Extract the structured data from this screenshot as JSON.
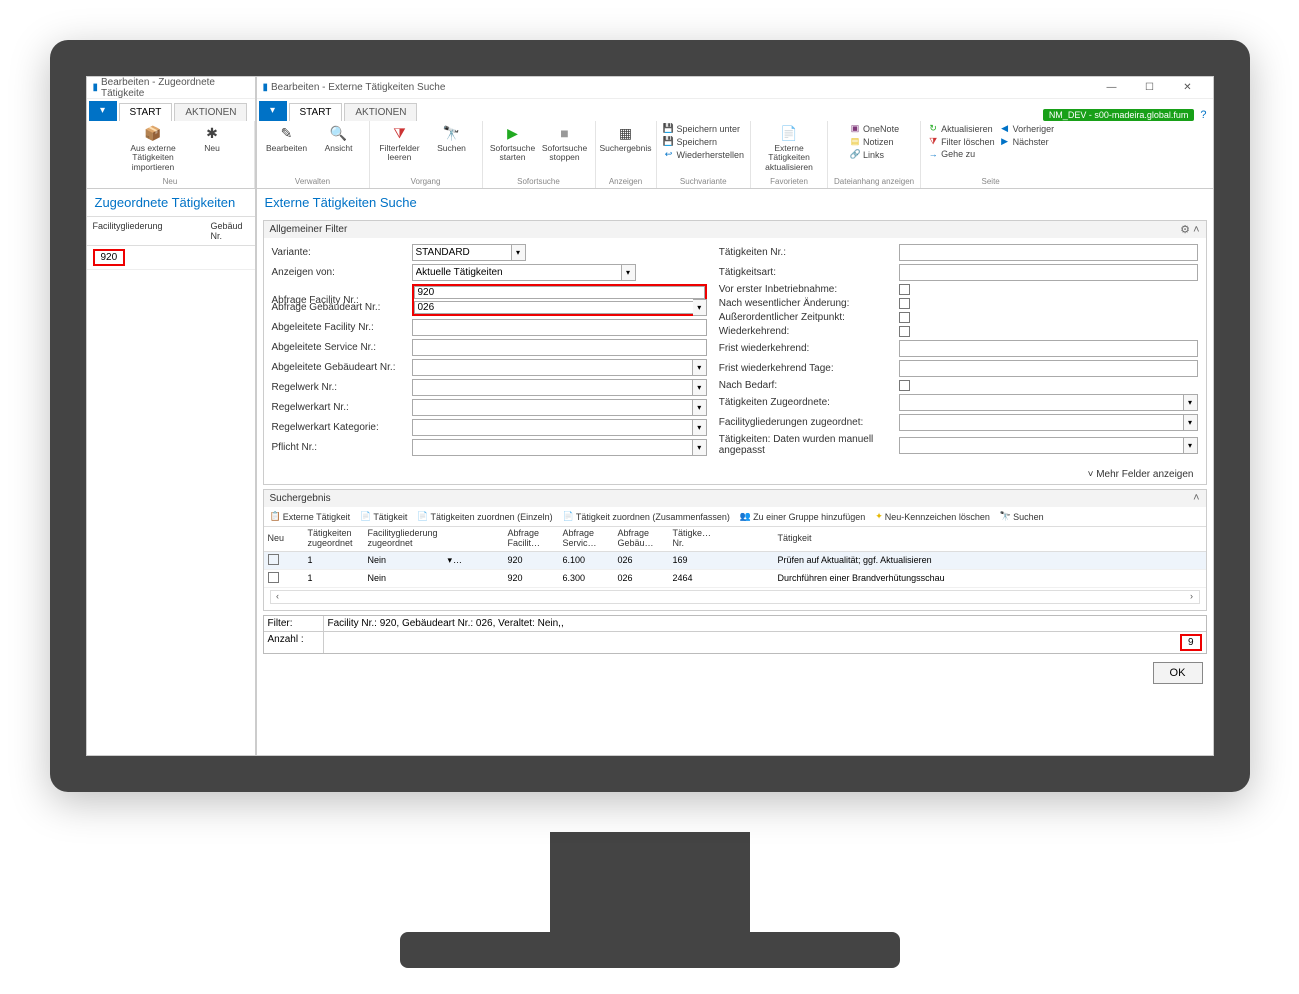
{
  "left_window": {
    "title": "Bearbeiten - Zugeordnete Tätigkeite",
    "tabs": [
      "START",
      "AKTIONEN"
    ],
    "ribbon": {
      "group_label": "Neu",
      "import_btn": "Aus externe Tätigkeiten importieren",
      "new_btn": "Neu"
    },
    "page_title": "Zugeordnete Tätigkeiten",
    "columns": {
      "c1": "Facilitygliederung",
      "c2": "Gebäud Nr."
    },
    "row1_c1": "920"
  },
  "right_window": {
    "title": "Bearbeiten - Externe Tätigkeiten Suche",
    "tabs": [
      "START",
      "AKTIONEN"
    ],
    "env_badge": "NM_DEV - s00-madeira.global.fum",
    "ribbon": {
      "g1": {
        "label": "Verwalten",
        "b1": "Bearbeiten",
        "b2": "Ansicht"
      },
      "g2": {
        "label": "Vorgang",
        "b1": "Filterfelder leeren",
        "b2": "Suchen"
      },
      "g3": {
        "label": "Sofortsuche",
        "b1": "Sofortsuche starten",
        "b2": "Sofortsuche stoppen"
      },
      "g4": {
        "label": "Anzeigen",
        "b1": "Suchergebnis"
      },
      "g5": {
        "label": "Suchvariante",
        "b1": "Speichern unter",
        "b2": "Speichern",
        "b3": "Wiederherstellen"
      },
      "g6": {
        "label": "Favorieten",
        "b1": "Externe Tätigkeiten aktualisieren"
      },
      "g7": {
        "label": "Dateianhang anzeigen",
        "b1": "OneNote",
        "b2": "Notizen",
        "b3": "Links"
      },
      "g8": {
        "label": "Seite",
        "b1": "Aktualisieren",
        "b2": "Filter löschen",
        "b3": "Gehe zu",
        "b4": "Vorheriger",
        "b5": "Nächster"
      }
    },
    "page_title": "Externe Tätigkeiten Suche",
    "filter_header": "Allgemeiner Filter",
    "labels": {
      "variante": "Variante:",
      "anzeigen_von": "Anzeigen von:",
      "abfrage_facility": "Abfrage Facility Nr.:",
      "abfrage_gebaudeart": "Abfrage Gebäudeart Nr.:",
      "abg_facility": "Abgeleitete Facility Nr.:",
      "abg_service": "Abgeleitete Service Nr.:",
      "abg_gebaudeart": "Abgeleitete Gebäudeart Nr.:",
      "regelwerk": "Regelwerk Nr.:",
      "regelwerkart": "Regelwerkart Nr.:",
      "regelwerkart_kat": "Regelwerkart Kategorie:",
      "pflicht": "Pflicht Nr.:",
      "taetigkeiten_nr": "Tätigkeiten Nr.:",
      "taetigkeitsart": "Tätigkeitsart:",
      "vor_erster": "Vor erster Inbetriebnahme:",
      "nach_wesentlicher": "Nach wesentlicher Änderung:",
      "ausserordentlicher": "Außerordentlicher Zeitpunkt:",
      "wiederkehrend": "Wiederkehrend:",
      "frist_wiederkehrend": "Frist wiederkehrend:",
      "frist_tage": "Frist wiederkehrend Tage:",
      "nach_bedarf": "Nach Bedarf:",
      "zugeordnete": "Tätigkeiten Zugeordnete:",
      "facility_zugeordnet": "Facilitygliederungen zugeordnet:",
      "manuell": "Tätigkeiten: Daten wurden manuell angepasst"
    },
    "values": {
      "variante": "STANDARD",
      "anzeigen_von": "Aktuelle Tätigkeiten",
      "abfrage_facility": "920",
      "abfrage_gebaudeart": "026"
    },
    "more_fields": "Mehr Felder anzeigen",
    "result_header": "Suchergebnis",
    "toolbar": {
      "t1": "Externe Tätigkeit",
      "t2": "Tätigkeit",
      "t3": "Tätigkeiten zuordnen (Einzeln)",
      "t4": "Tätigkeit zuordnen (Zusammenfassen)",
      "t5": "Zu einer Gruppe hinzufügen",
      "t6": "Neu-Kennzeichen löschen",
      "t7": "Suchen"
    },
    "cols": {
      "c1": "Neu",
      "c2": "Tätigkeiten zugeordnet",
      "c3": "Facilitygliederung zugeordnet",
      "c4": "",
      "c5": "Abfrage Facilit…",
      "c6": "Abfrage Servic…",
      "c7": "Abfrage Gebäu…",
      "c8": "Tätigke… Nr.",
      "c9": "",
      "c10": "Tätigkeit"
    },
    "rows": [
      {
        "neu": "",
        "tz": "1",
        "fz": "Nein",
        "f": "920",
        "s": "6.100",
        "g": "026",
        "tnr": "169",
        "t": "Prüfen auf Aktualität; ggf. Aktualisieren"
      },
      {
        "neu": "",
        "tz": "1",
        "fz": "Nein",
        "f": "920",
        "s": "6.300",
        "g": "026",
        "tnr": "2464",
        "t": "Durchführen einer Brandverhütungsschau"
      }
    ],
    "footer": {
      "filter_k": "Filter:",
      "filter_v": "Facility Nr.: 920, Gebäudeart Nr.: 026, Veraltet: Nein,,",
      "count_k": "Anzahl :",
      "count_v": "9"
    },
    "ok": "OK"
  }
}
